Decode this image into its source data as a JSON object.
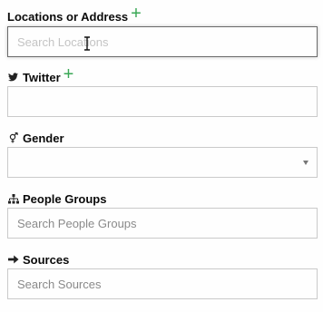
{
  "fields": {
    "locations": {
      "label": "Locations or Address",
      "placeholder": "Search Locations",
      "add_icon": "plus-icon"
    },
    "twitter": {
      "label": "Twitter",
      "icon": "twitter-icon",
      "value": "",
      "add_icon": "plus-icon"
    },
    "gender": {
      "label": "Gender",
      "icon": "gender-icon",
      "selected": ""
    },
    "people_groups": {
      "label": "People Groups",
      "icon": "sitemap-icon",
      "placeholder": "Search People Groups"
    },
    "sources": {
      "label": "Sources",
      "icon": "arrow-right-icon",
      "placeholder": "Search Sources"
    }
  },
  "colors": {
    "add_accent": "#3aa856",
    "border": "#cacaca",
    "focus_border": "#6a6a6a"
  }
}
